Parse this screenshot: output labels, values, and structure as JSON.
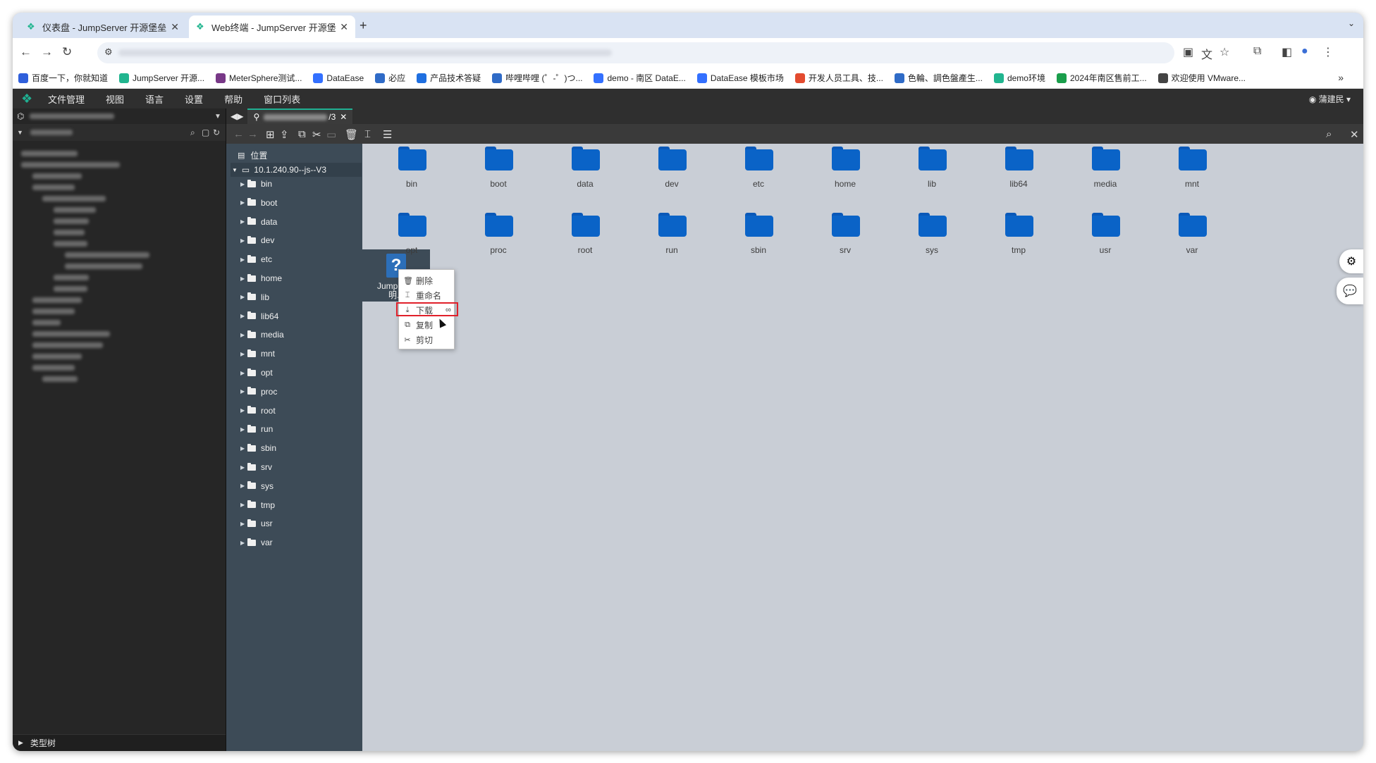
{
  "browser": {
    "tabs": [
      {
        "title": "仪表盘 - JumpServer 开源堡垒",
        "active": false
      },
      {
        "title": "Web终端 - JumpServer 开源堡",
        "active": true
      }
    ],
    "new_tab": "+",
    "bookmarks": [
      {
        "label": "百度一下，你就知道",
        "icon_color": "#2f5fdb"
      },
      {
        "label": "JumpServer 开源...",
        "icon_color": "#21b58f"
      },
      {
        "label": "MeterSphere测试...",
        "icon_color": "#783887"
      },
      {
        "label": "DataEase",
        "icon_color": "#3370ff"
      },
      {
        "label": "必应",
        "icon_color": "#2f6bc7"
      },
      {
        "label": "产品技术答疑",
        "icon_color": "#1f6fe0"
      },
      {
        "label": "哔哩哔哩 (゜-゜)つ...",
        "icon_color": "#2f6bc7"
      },
      {
        "label": "demo - 南区 DataE...",
        "icon_color": "#3370ff"
      },
      {
        "label": "DataEase 模板市场",
        "icon_color": "#3370ff"
      },
      {
        "label": "开发人员工具、技...",
        "icon_color": "#e34b2f"
      },
      {
        "label": "色輪、調色盤產生...",
        "icon_color": "#2f6bc7"
      },
      {
        "label": "demo环境",
        "icon_color": "#21b58f"
      },
      {
        "label": "2024年南区售前工...",
        "icon_color": "#1a9e4b"
      },
      {
        "label": "欢迎使用 VMware...",
        "icon_color": "#444444"
      }
    ]
  },
  "app": {
    "menu": [
      "文件管理",
      "视图",
      "语言",
      "设置",
      "帮助",
      "窗口列表"
    ],
    "user": "蒲建民"
  },
  "left_pane": {
    "footer": "类型树"
  },
  "session": {
    "tab_suffix": "/3"
  },
  "nav_pane": {
    "location_label": "位置",
    "root": "10.1.240.90--js--V3",
    "folders": [
      "bin",
      "boot",
      "data",
      "dev",
      "etc",
      "home",
      "lib",
      "lib64",
      "media",
      "mnt",
      "opt",
      "proc",
      "root",
      "run",
      "sbin",
      "srv",
      "sys",
      "tmp",
      "usr",
      "var"
    ]
  },
  "main": {
    "folders": [
      "bin",
      "boot",
      "data",
      "dev",
      "etc",
      "home",
      "lib",
      "lib64",
      "media",
      "mnt",
      "opt",
      "proc",
      "root",
      "run",
      "sbin",
      "srv",
      "sys",
      "tmp",
      "usr",
      "var"
    ],
    "selected_file": {
      "line1": "JumpServ",
      "line2": "明.d"
    },
    "context_menu": [
      "删除",
      "重命名",
      "下载",
      "复制",
      "剪切"
    ]
  },
  "colors": {
    "accent": "#1fb092",
    "folder": "#0a63c7",
    "highlight": "#e0202a"
  }
}
